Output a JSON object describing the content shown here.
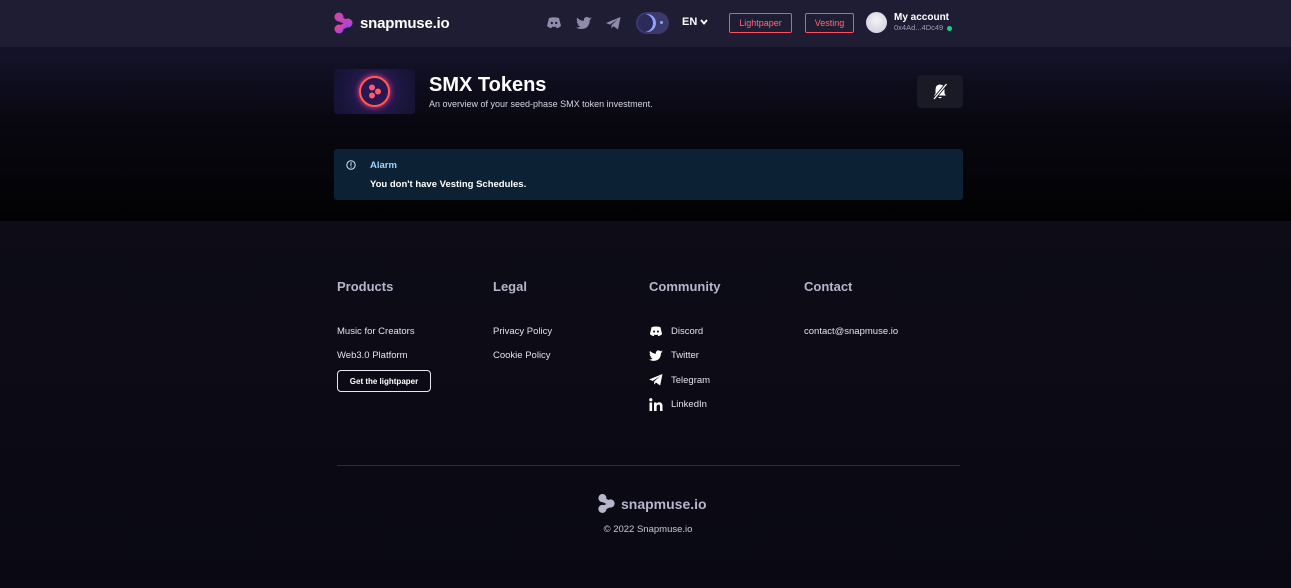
{
  "header": {
    "brand": "snapmuse.io",
    "social_icons": [
      "discord-icon",
      "twitter-icon",
      "telegram-icon"
    ],
    "theme_toggle": "dark",
    "language": "EN",
    "lightpaper_label": "Lightpaper",
    "vesting_label": "Vesting",
    "account": {
      "title": "My account",
      "address": "0x4Ad...4Dc49",
      "status_color": "#19d08a"
    }
  },
  "hero": {
    "title": "SMX Tokens",
    "subtitle": "An overview of your seed-phase SMX token investment.",
    "notification_icon": "bell-off-icon"
  },
  "alarm": {
    "title": "Alarm",
    "message": "You don't have Vesting Schedules."
  },
  "footer": {
    "columns": [
      {
        "heading": "Products",
        "links": [
          "Music for Creators",
          "Web3.0 Platform"
        ],
        "button": "Get the lightpaper"
      },
      {
        "heading": "Legal",
        "links": [
          "Privacy Policy",
          "Cookie Policy"
        ]
      },
      {
        "heading": "Community",
        "links": [
          {
            "label": "Discord",
            "icon": "discord-icon"
          },
          {
            "label": "Twitter",
            "icon": "twitter-icon"
          },
          {
            "label": "Telegram",
            "icon": "telegram-icon"
          },
          {
            "label": "LinkedIn",
            "icon": "linkedin-icon"
          }
        ]
      },
      {
        "heading": "Contact",
        "links": [
          "contact@snapmuse.io"
        ]
      }
    ],
    "brand": "snapmuse.io",
    "copyright": "© 2022 Snapmuse.io"
  },
  "colors": {
    "accent": "#ff4d5e",
    "header_bg": "#1f1d33",
    "alarm_bg": "#0c2133",
    "alarm_title": "#9cd4ff"
  }
}
